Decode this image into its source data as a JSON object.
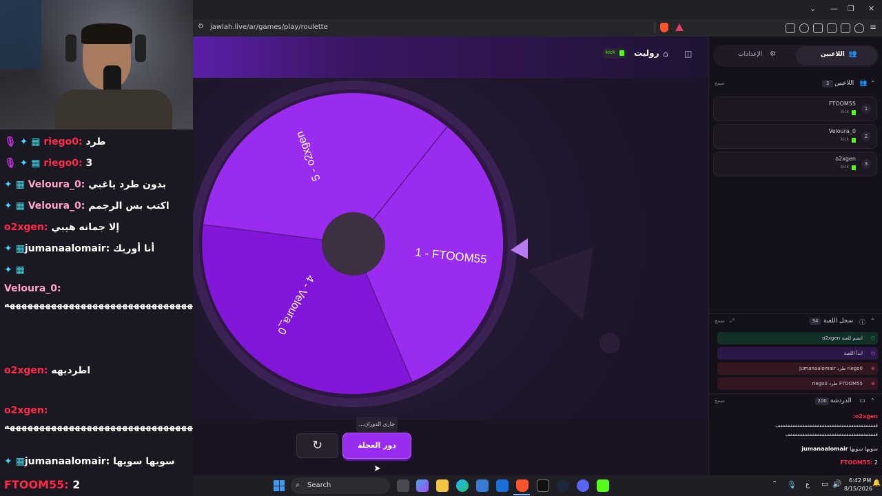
{
  "browser": {
    "url": "jawlah.live/ar/games/play/roulette"
  },
  "header": {
    "title": "روليت",
    "platform_badge": "kick"
  },
  "wheel": {
    "segments": [
      {
        "label": "1 - FTOOM55",
        "color": "#9a2cf0"
      },
      {
        "label": "4 - Veloura_0",
        "color": "#8216d9"
      },
      {
        "label": "5 - o2xgen",
        "color": "#9a2cf0"
      }
    ]
  },
  "controls": {
    "status_tooltip": "...جاري الدوران",
    "spin_button": "دور العجلة"
  },
  "sidebar": {
    "tab_players": "اللاعبين",
    "tab_settings": "الإعدادات",
    "players_section": {
      "title": "اللاعبين",
      "count": "3",
      "clear": "مسح",
      "players": [
        {
          "name": "FTOOM55",
          "platform": "kick",
          "rank": "1"
        },
        {
          "name": "Veloura_0",
          "platform": "kick",
          "rank": "2"
        },
        {
          "name": "o2xgen",
          "platform": "kick",
          "rank": "3"
        }
      ]
    },
    "log_section": {
      "title": "سجل اللعبة",
      "count": "34",
      "clear": "مسح",
      "entries": [
        {
          "text": "o2xgen انضم للعبة",
          "bg": "#123027",
          "icon_color": "#2bd47a"
        },
        {
          "text": "ابدأ اللعبة",
          "bg": "#2c1848",
          "icon_color": "#a55cf2"
        },
        {
          "text": "jumanaalomair طرد riego0",
          "bg": "#33161f",
          "icon_color": "#f0456a"
        },
        {
          "text": "riego0 طرد FTOOM55",
          "bg": "#33161f",
          "icon_color": "#f0456a"
        }
      ]
    },
    "chat_section": {
      "title": "الدردشة",
      "count": "200",
      "clear": "مسح",
      "lines": [
        {
          "user": ":o2xgen",
          "text": ""
        },
        {
          "user": "",
          "text": "ففففففففففففففففففففففففففففففففففففففففف"
        },
        {
          "user": "",
          "text": "ففففففففففففففففففففففففففففففففففففف"
        },
        {
          "user": "jumanaalomair",
          "text": "سويها سويها"
        },
        {
          "user": "FTOOM55:",
          "text": "2"
        }
      ]
    }
  },
  "stream_chat": {
    "lines": [
      {
        "user": "riego0:",
        "text": "طرد",
        "user_color": "#ff2a4a",
        "badges": "mic-sword-bot"
      },
      {
        "user": "riego0:",
        "text": "3",
        "user_color": "#ff2a4a",
        "badges": "mic-sword-bot"
      },
      {
        "user": "Veloura_0:",
        "text": "بدون طرد ياغبي",
        "user_color": "#ffa3c8",
        "badges": "sword-bot"
      },
      {
        "user": "Veloura_0:",
        "text": "اكتب بس الرجمم",
        "user_color": "#ffa3c8",
        "badges": "sword-bot"
      },
      {
        "user": "o2xgen:",
        "text": "إلا جمانه هيبي",
        "user_color": "#ff2a4a",
        "badges": ""
      },
      {
        "user": "jumanaalomair:",
        "text": "أنا أوريك",
        "user_color": "#39d7e8",
        "badges": "sword-bot"
      },
      {
        "user": "Veloura_0:",
        "text": "ههههههههههههههههههههههههههههههههههههههههههههههههههههههههههههههههههههههههه",
        "user_color": "#ffa3c8",
        "badges": "sword-bot"
      },
      {
        "user": "o2xgen:",
        "text": "اطرديهه",
        "user_color": "#ff2a4a",
        "badges": ""
      },
      {
        "user": "o2xgen:",
        "text": "هههههههههههههههههههههههههههههههههههههههههههه",
        "user_color": "#ff2a4a",
        "badges": ""
      },
      {
        "user": "jumanaalomair:",
        "text": "سويها سويها",
        "user_color": "#39d7e8",
        "badges": "sword-bot"
      },
      {
        "user": "FTOOM55:",
        "text": "2",
        "user_color": "#ff2a4a",
        "badges": ""
      }
    ]
  },
  "taskbar": {
    "search_placeholder": "Search",
    "time": "6:42 PM",
    "date": "8/15/2026",
    "lang": "ع"
  }
}
